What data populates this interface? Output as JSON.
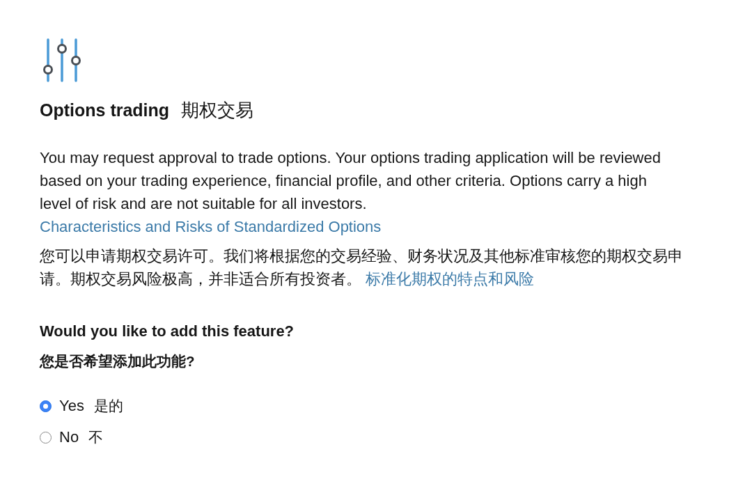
{
  "header": {
    "title": "Options trading",
    "title_zh": "期权交易"
  },
  "description": {
    "text": "You may request approval to trade options. Your options trading application will be reviewed based on your trading experience, financial profile, and other criteria. Options carry a high level of risk and are not suitable for all investors.",
    "link": "Characteristics and Risks of Standardized Options"
  },
  "description_zh": {
    "text": "您可以申请期权交易许可。我们将根据您的交易经验、财务状况及其他标准审核您的期权交易申请。期权交易风险极高，并非适合所有投资者。",
    "link": "标准化期权的特点和风险"
  },
  "question": {
    "text": "Would you like to add this feature?",
    "text_zh": "您是否希望添加此功能?"
  },
  "options": [
    {
      "label": "Yes",
      "label_zh": "是的",
      "selected": true
    },
    {
      "label": "No",
      "label_zh": "不",
      "selected": false
    }
  ]
}
